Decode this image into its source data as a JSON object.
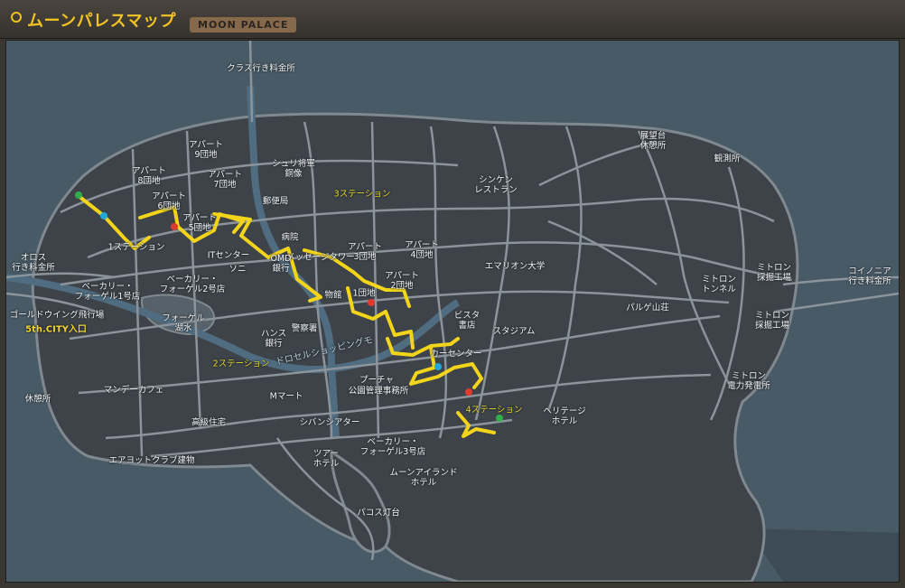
{
  "header": {
    "title": "ムーンパレスマップ",
    "subtitle": "MOON PALACE"
  },
  "colors": {
    "land": "#3d4349",
    "water": "#485a66",
    "road": "#8b949a",
    "route": "#f2d41a",
    "marker_green": "#2fae4a",
    "marker_blue": "#23a7d6",
    "marker_red": "#e03a2e",
    "station_text": "#e9d62a"
  },
  "labels": {
    "crass_toll": "クラス行き料金所",
    "observatory_rest": "展望台\n休憩所",
    "whale_watch": "観測所",
    "apart9": "アパート\n9団地",
    "apart8": "アパート\n8団地",
    "apart7": "アパート\n7団地",
    "shuri_statue": "シュリ将軍\n銅像",
    "shinken_restaurant": "シンケン\nレストラン",
    "apart6": "アパート\n6団地",
    "post_office": "郵便局",
    "station3": "3ステーション",
    "apart5": "アパート\n5団地",
    "it_center": "ITセンター",
    "hospital": "病院",
    "apart3": "アパート\n3団地",
    "apart4": "アパート\n4団地",
    "station1": "1ステーション",
    "message_tower": "メッセージタワー",
    "omd_bank": "OMD\n銀行",
    "sony": "ソニ",
    "oros_toll": "オロス\n行き料金所",
    "bakery1": "ベーカリー・\nフォーゲル1号店",
    "bakery2": "ベーカリー・\nフォーゲル2号店",
    "museum": "物館",
    "apart1": "1団地",
    "apart2": "アパート\n2団地",
    "emarion_univ": "エマリオン大学",
    "mitoron_tunnel": "ミトロン\nトンネル",
    "mitoron_mine": "ミトロン\n採掘工場",
    "koinoria_toll": "コイノニア\n行き料金所",
    "pargue_mt": "パルゲ山荘",
    "mitoron_mine2": "ミトロン\n採掘工場",
    "goldwing_airport": "ゴールドウイング飛行場",
    "foguel_lake": "フォーゲル\n湖水",
    "cityentrance": "5th.CITY入口",
    "hans_bank": "ハンス\n銀行",
    "police": "警察署",
    "vistas_bookstore": "ビスタ\n書店",
    "stadium": "スタジアム",
    "station2": "2ステーション",
    "drosel_shopping": "ドロセルショッピングモ",
    "car_center": "カーセンター",
    "park_office": "公園管理事務所",
    "bogeton": "プーチャ",
    "rest_area": "休憩所",
    "monday_cafe": "マンデーカフェ",
    "m_mart": "Mマート",
    "mitoron_power": "ミトロン\n電力発電所",
    "station4": "4ステーション",
    "heritage_hotel": "ヘリテージ\nホテル",
    "luxury_housing": "高級住宅",
    "shivan_theater": "シバンシアター",
    "bakery3": "ベーカリー・\nフォーゲル3号店",
    "tsuaa_hotel": "ツアー\nホテル",
    "air_yacht": "エアヨットクラブ建物",
    "moon_island_hotel": "ムーンアイランド\nホテル",
    "pacos_lighthouse": "パコス灯台"
  }
}
